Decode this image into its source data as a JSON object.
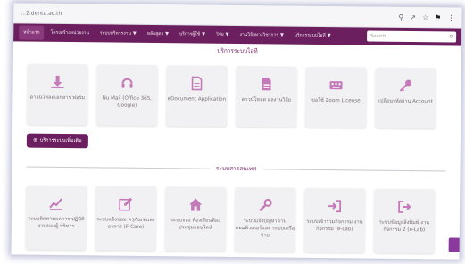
{
  "browser": {
    "url": "...2.dentu.ac.th",
    "icons": [
      "search-icon",
      "star-icon",
      "extension-icon",
      "menu-icon"
    ]
  },
  "nav": {
    "items": [
      {
        "label": "หน้าแรก",
        "caret": false,
        "active": true
      },
      {
        "label": "โครงสร้างหน่วยงาน",
        "caret": false
      },
      {
        "label": "ระบบบริหารงาน",
        "caret": true
      },
      {
        "label": "หลักสูตร",
        "caret": true
      },
      {
        "label": "บริการผู้ใช้",
        "caret": true
      },
      {
        "label": "วิจัย",
        "caret": true
      },
      {
        "label": "งานวิจัยทางวิชาการ",
        "caret": true
      },
      {
        "label": "บริการระบบไอที",
        "caret": true
      }
    ],
    "search_placeholder": "Search"
  },
  "services": {
    "title": "บริการระบบไอที",
    "tiles": [
      {
        "label": "ดาวน์โหลดเอกสาร ฟอร์ม",
        "icon": "download-icon"
      },
      {
        "label": "Nu Mail (Office 365, Google)",
        "icon": "headset-icon"
      },
      {
        "label": "eDocument Application",
        "icon": "document-icon"
      },
      {
        "label": "ดาวน์โหลด ผลงานวิจัย",
        "icon": "file-icon"
      },
      {
        "label": "ขอใช้ Zoom License",
        "icon": "keyboard-icon"
      },
      {
        "label": "เปลี่ยนรหัสผ่าน Account",
        "icon": "key-icon"
      }
    ],
    "more_button": "บริการระบบเพิ่มเติม"
  },
  "systems": {
    "title": "ระบบสารสนเทศ",
    "tiles": [
      {
        "label": "ระบบติดตามผลการ ปฏิบัติงานของผู้ บริหาร",
        "icon": "chart-icon"
      },
      {
        "label": "ระบบแจ้งซ่อม ครุภัณฑ์และอาคาร (F-Care)",
        "icon": "edit-icon"
      },
      {
        "label": "ระบบจอง ห้องเรียนห้อง ประชุมออนไลน์",
        "icon": "home-icon"
      },
      {
        "label": "ระบบแจ้งปัญหาด้าน คอมพิวเตอร์และ ระบบเครือข่าย",
        "icon": "wrench-icon"
      },
      {
        "label": "ระบบเข้าร่วมกิจกรรม งานกิจกรรม (e-Lab)",
        "icon": "sign-in-icon"
      },
      {
        "label": "ระบบข้อมูลสิ่งพิมพ์ งานกิจกรรม 2 (e-Lab)",
        "icon": "sign-out-icon"
      }
    ]
  },
  "colors": {
    "primary": "#6b1f5e",
    "accent": "#c47ab8"
  }
}
